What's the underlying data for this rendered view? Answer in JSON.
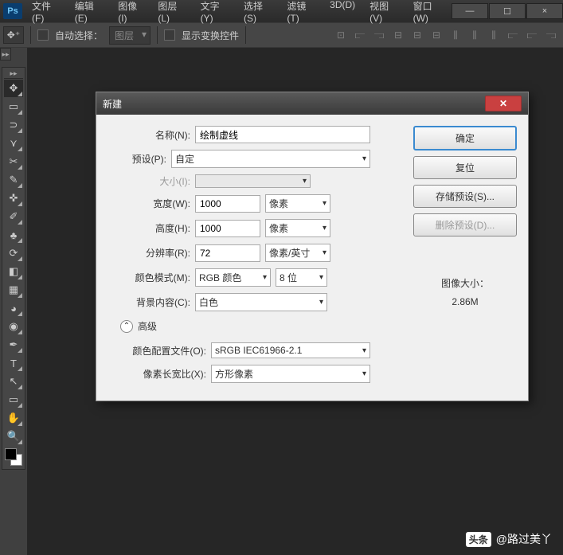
{
  "app": {
    "logo": "Ps"
  },
  "menu": {
    "items": [
      "文件(F)",
      "编辑(E)",
      "图像(I)",
      "图层(L)",
      "文字(Y)",
      "选择(S)",
      "滤镜(T)",
      "3D(D)",
      "视图(V)",
      "窗口(W)"
    ]
  },
  "window_buttons": {
    "min": "—",
    "max": "☐",
    "close": "×"
  },
  "options_bar": {
    "auto_select": "自动选择：",
    "layer_select": "图层",
    "show_transform": "显示变换控件"
  },
  "dialog": {
    "title": "新建",
    "name_label": "名称(N):",
    "name_value": "绘制虚线",
    "preset_label": "预设(P):",
    "preset_value": "自定",
    "size_label": "大小(I):",
    "width_label": "宽度(W):",
    "width_value": "1000",
    "width_unit": "像素",
    "height_label": "高度(H):",
    "height_value": "1000",
    "height_unit": "像素",
    "resolution_label": "分辨率(R):",
    "resolution_value": "72",
    "resolution_unit": "像素/英寸",
    "color_mode_label": "颜色模式(M):",
    "color_mode_value": "RGB 颜色",
    "bit_depth": "8 位",
    "bg_label": "背景内容(C):",
    "bg_value": "白色",
    "advanced": "高级",
    "profile_label": "颜色配置文件(O):",
    "profile_value": "sRGB IEC61966-2.1",
    "aspect_label": "像素长宽比(X):",
    "aspect_value": "方形像素",
    "ok": "确定",
    "reset": "复位",
    "save_preset": "存储预设(S)...",
    "delete_preset": "删除预设(D)...",
    "image_size_label": "图像大小：",
    "image_size_value": "2.86M"
  },
  "watermark": {
    "logo": "头条",
    "text": "@路过美丫"
  }
}
